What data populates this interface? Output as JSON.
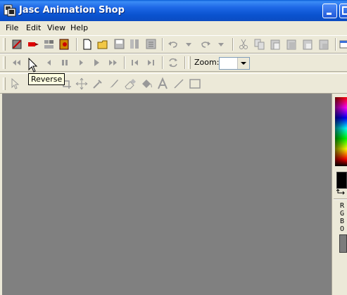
{
  "window": {
    "title": "Jasc Animation Shop"
  },
  "menu": {
    "items": [
      "File",
      "Edit",
      "View",
      "Help"
    ]
  },
  "toolbar_zoom": {
    "label": "Zoom:",
    "value": ""
  },
  "tooltip": {
    "text": "Reverse"
  },
  "color_panel": {
    "channels": [
      "R",
      "G",
      "B",
      "O"
    ]
  }
}
